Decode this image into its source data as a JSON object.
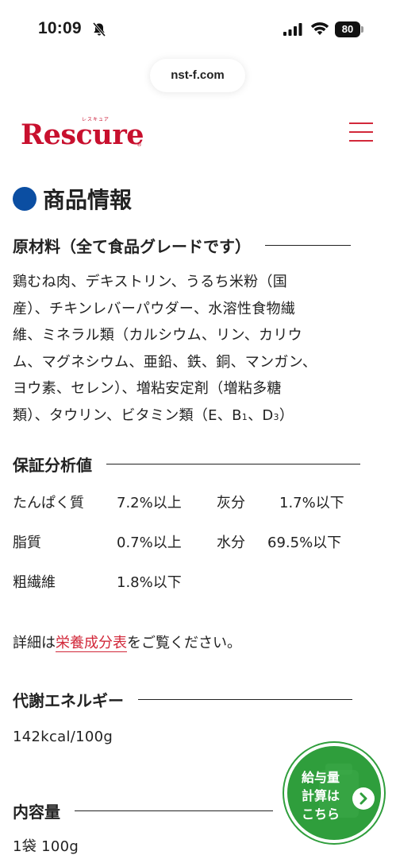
{
  "status_bar": {
    "time": "10:09",
    "battery": "80"
  },
  "browser": {
    "url": "nst-f.com"
  },
  "header": {
    "logo_text": "Rescure",
    "logo_ruby": "レスキュア",
    "logo_reg": "®"
  },
  "section": {
    "title": "商品情報",
    "ingredients_heading": "原材料（全て食品グレードです）",
    "ingredients_lines": [
      "鶏むね肉、デキストリン、うるち米粉（国",
      "産）、チキンレバーパウダー、水溶性食物繊",
      "維、ミネラル類（カルシウム、リン、カリウ",
      "ム、マグネシウム、亜鉛、鉄、銅、マンガン、",
      "ヨウ素、セレン）、増粘安定剤（増粘多糖",
      "類）、タウリン、ビタミン類（E、B"
    ],
    "ingredients_b_sub": "1",
    "ingredients_sep": "、D",
    "ingredients_d_sub": "3",
    "ingredients_close": "）",
    "analysis_heading": "保証分析値",
    "analysis": [
      {
        "label1": "たんぱく質",
        "value1": "7.2%以上",
        "label2": "灰分",
        "value2": "1.7%以下"
      },
      {
        "label1": "脂質",
        "value1": "0.7%以上",
        "label2": "水分",
        "value2": "69.5%以下"
      },
      {
        "label1": "粗繊維",
        "value1": "1.8%以下",
        "label2": "",
        "value2": ""
      }
    ],
    "detail_prefix": "詳細は",
    "detail_link": "栄養成分表",
    "detail_suffix": "をご覧ください。",
    "energy_heading": "代謝エネルギー",
    "energy_value": "142kcal/100g",
    "content_heading": "内容量",
    "content_value": "1袋 100g"
  },
  "float_button": {
    "lines": [
      "給与量",
      "計算は",
      "こちら"
    ]
  },
  "colors": {
    "brand_red": "#c8102e",
    "dot_blue": "#0b4ea2",
    "button_green": "#2f9e3c"
  }
}
